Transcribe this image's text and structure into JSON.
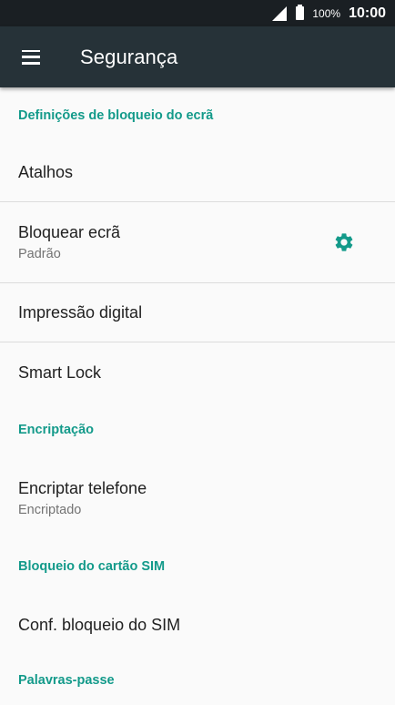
{
  "status_bar": {
    "battery_percent": "100%",
    "time": "10:00",
    "icons": [
      "signal-icon",
      "battery-icon"
    ]
  },
  "app_bar": {
    "title": "Segurança",
    "menu_icon": "menu-icon"
  },
  "colors": {
    "status_bar": "#1a1f23",
    "app_bar": "#263238",
    "accent": "#139a8a",
    "background": "#fafafa",
    "divider": "#dcdcdc"
  },
  "sections": {
    "screen_lock": {
      "header": "Definições de bloqueio do ecrã",
      "items": [
        {
          "title": "Atalhos"
        },
        {
          "title": "Bloquear ecrã",
          "summary": "Padrão",
          "action_icon": "gear-icon"
        },
        {
          "title": "Impressão digital"
        },
        {
          "title": "Smart Lock"
        }
      ]
    },
    "encryption": {
      "header": "Encriptação",
      "items": [
        {
          "title": "Encriptar telefone",
          "summary": "Encriptado"
        }
      ]
    },
    "sim_lock": {
      "header": "Bloqueio do cartão SIM",
      "items": [
        {
          "title": "Conf. bloqueio do SIM"
        }
      ]
    },
    "passwords": {
      "header": "Palavras-passe"
    }
  }
}
